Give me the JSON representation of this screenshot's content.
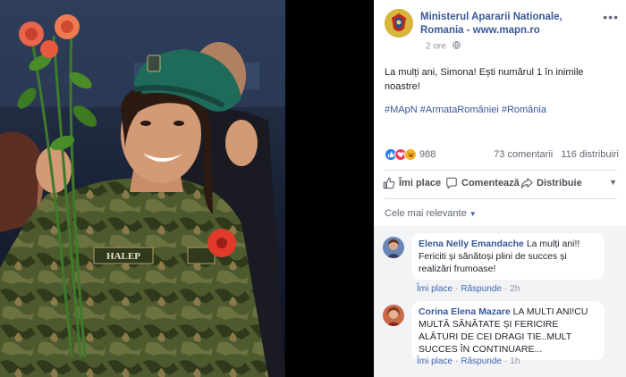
{
  "post": {
    "page_name": "Ministerul Apararii Nationale, Romania - www.mapn.ro",
    "time": "2 ore",
    "text": "La mulți ani, Simona! Ești numărul 1 în inimile noastre!",
    "hashtags": "#MApN #ArmataRomâniei #România",
    "more_label": "•••"
  },
  "stats": {
    "reactions_count": "988",
    "comments": "73 comentarii",
    "shares": "116 distribuiri"
  },
  "actions": {
    "like": "Îmi place",
    "comment": "Comentează",
    "share": "Distribuie"
  },
  "sort": {
    "label": "Cele mai relevante"
  },
  "photo": {
    "name_tag": "HALEP"
  },
  "comments": [
    {
      "author": "Elena Nelly Emandache",
      "text": "La mulți ani!! Fericiti și sănătoși plini de succes și realizări frumoase!",
      "like_label": "Îmi place",
      "reply_label": "Răspunde",
      "time": "2h"
    },
    {
      "author": "Corina Elena Mazare",
      "text": "LA MULTI ANI!CU MULTĂ SĂNĂTATE ȘI FERICIRE ALĂTURI DE CEI DRAGI TIE..MULT SUCCES ÎN CONTINUARE...",
      "like_label": "Îmi place",
      "reply_label": "Răspunde",
      "time": "1h"
    }
  ],
  "colors": {
    "link": "#385898",
    "like_blue": "#2078f4",
    "love_red": "#f33e58",
    "haha_yellow": "#f7b125"
  }
}
